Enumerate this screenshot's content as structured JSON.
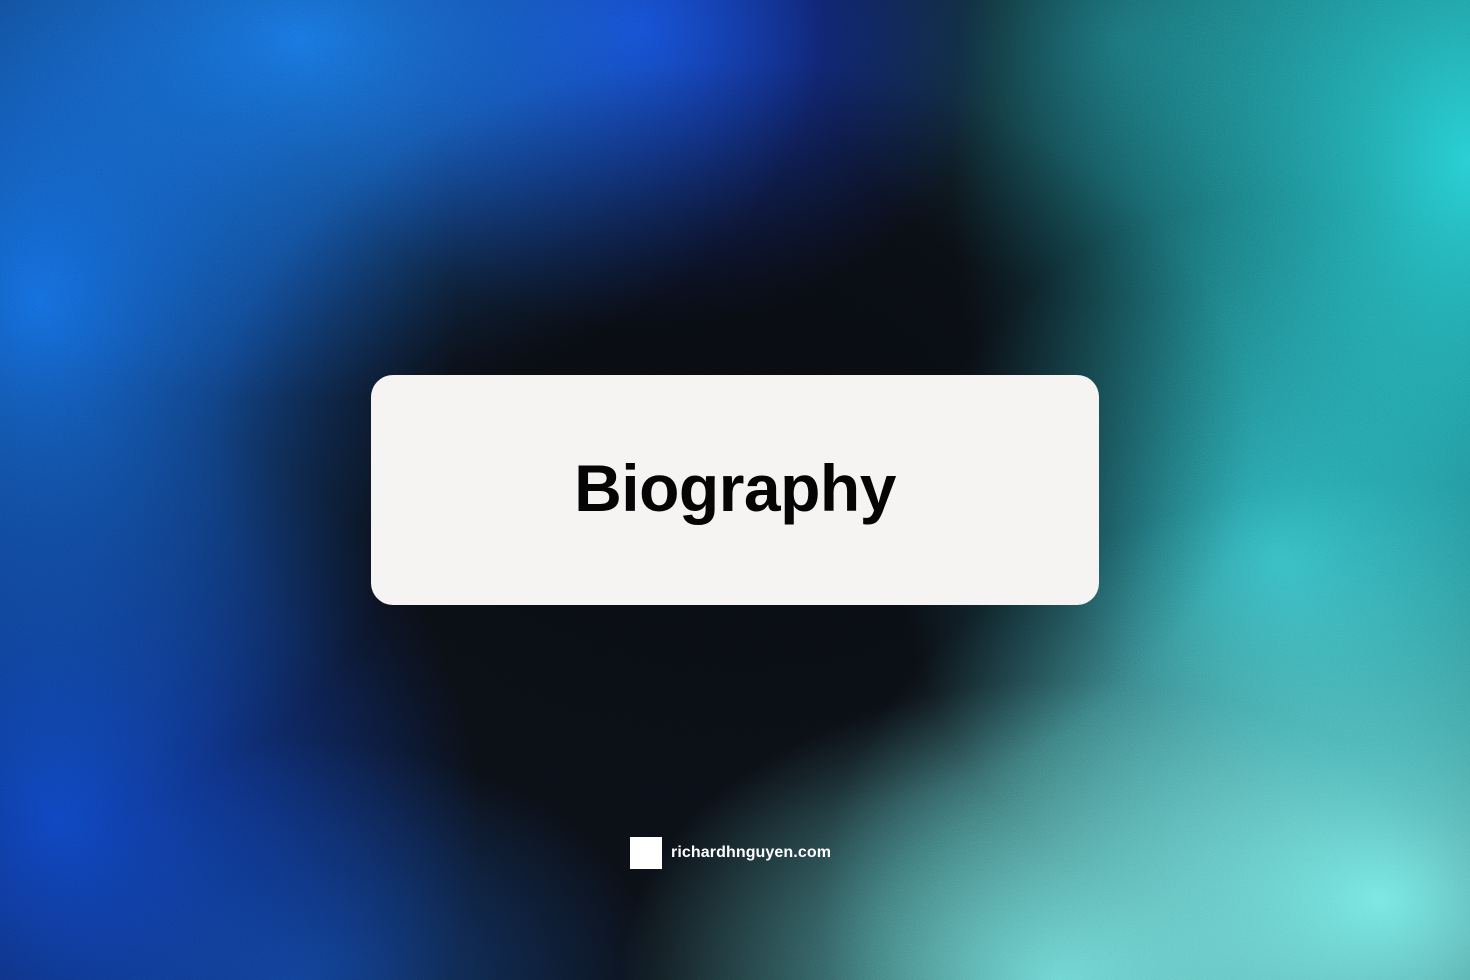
{
  "card": {
    "title": "Biography"
  },
  "footer": {
    "site": "richardhnguyen.com",
    "logo_icon": "white-square-logo-icon"
  },
  "colors": {
    "card_background": "#f6f4f2",
    "title_text": "#050505",
    "footer_text": "#ffffff",
    "background_blue": "#1470e6",
    "background_cyan": "#28d7dc",
    "background_dark": "#0b0f16"
  }
}
